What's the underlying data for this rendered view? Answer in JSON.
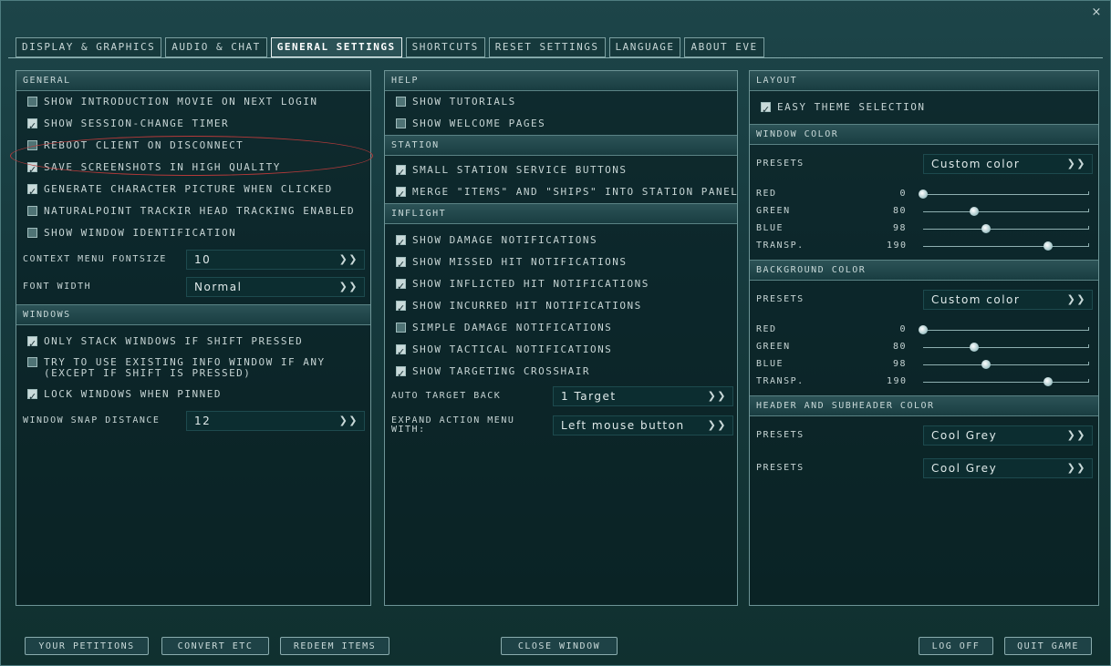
{
  "tabs": [
    {
      "label": "DISPLAY & GRAPHICS"
    },
    {
      "label": "AUDIO & CHAT"
    },
    {
      "label": "GENERAL SETTINGS"
    },
    {
      "label": "SHORTCUTS"
    },
    {
      "label": "RESET SETTINGS"
    },
    {
      "label": "LANGUAGE"
    },
    {
      "label": "ABOUT EVE"
    }
  ],
  "close": "×",
  "general": {
    "header": "GENERAL",
    "checks": [
      {
        "label": "SHOW INTRODUCTION MOVIE ON NEXT LOGIN",
        "checked": false
      },
      {
        "label": "SHOW SESSION-CHANGE TIMER",
        "checked": true
      },
      {
        "label": "REBOOT CLIENT ON DISCONNECT",
        "checked": false
      },
      {
        "label": "SAVE SCREENSHOTS IN HIGH QUALITY",
        "checked": true
      },
      {
        "label": "GENERATE CHARACTER PICTURE WHEN CLICKED",
        "checked": true
      },
      {
        "label": "NATURALPOINT TRACKIR HEAD TRACKING ENABLED",
        "checked": false
      },
      {
        "label": "SHOW WINDOW IDENTIFICATION",
        "checked": false
      }
    ],
    "context_menu_label": "CONTEXT MENU FONTSIZE",
    "context_menu_value": "10",
    "font_width_label": "FONT WIDTH",
    "font_width_value": "Normal",
    "windows_header": "WINDOWS",
    "win_checks": [
      {
        "label": "ONLY STACK WINDOWS IF SHIFT PRESSED",
        "checked": true
      },
      {
        "label": "TRY TO USE EXISTING INFO WINDOW IF ANY (EXCEPT IF SHIFT IS PRESSED)",
        "checked": false
      },
      {
        "label": "LOCK WINDOWS WHEN PINNED",
        "checked": true
      }
    ],
    "snap_label": "WINDOW SNAP DISTANCE",
    "snap_value": "12"
  },
  "help": {
    "header": "HELP",
    "checks": [
      {
        "label": "SHOW TUTORIALS",
        "checked": false
      },
      {
        "label": "SHOW WELCOME PAGES",
        "checked": false
      }
    ],
    "station_header": "STATION",
    "station_checks": [
      {
        "label": "SMALL STATION SERVICE BUTTONS",
        "checked": true
      },
      {
        "label": "MERGE \"ITEMS\" AND \"SHIPS\" INTO STATION PANEL",
        "checked": true
      }
    ],
    "inflight_header": "INFLIGHT",
    "inflight_checks": [
      {
        "label": "SHOW DAMAGE NOTIFICATIONS",
        "checked": true
      },
      {
        "label": "SHOW MISSED HIT NOTIFICATIONS",
        "checked": true
      },
      {
        "label": "SHOW INFLICTED HIT NOTIFICATIONS",
        "checked": true
      },
      {
        "label": "SHOW INCURRED HIT NOTIFICATIONS",
        "checked": true
      },
      {
        "label": "SIMPLE DAMAGE NOTIFICATIONS",
        "checked": false
      },
      {
        "label": "SHOW TACTICAL NOTIFICATIONS",
        "checked": true
      },
      {
        "label": "SHOW TARGETING CROSSHAIR",
        "checked": true
      }
    ],
    "auto_target_label": "AUTO TARGET BACK",
    "auto_target_value": "1 Target",
    "expand_label": "EXPAND ACTION MENU WITH:",
    "expand_value": "Left mouse button"
  },
  "layout": {
    "header": "LAYOUT",
    "easy_theme": {
      "label": "EASY THEME SELECTION",
      "checked": true
    },
    "window_color_header": "WINDOW COLOR",
    "presets_label": "PRESETS",
    "window_preset": "Custom color",
    "window_sliders": [
      {
        "label": "RED",
        "value": "0",
        "pos": 0.0
      },
      {
        "label": "GREEN",
        "value": "80",
        "pos": 0.31
      },
      {
        "label": "BLUE",
        "value": "98",
        "pos": 0.38
      },
      {
        "label": "TRANSP.",
        "value": "190",
        "pos": 0.75
      }
    ],
    "bg_color_header": "BACKGROUND COLOR",
    "bg_preset": "Custom color",
    "bg_sliders": [
      {
        "label": "RED",
        "value": "0",
        "pos": 0.0
      },
      {
        "label": "GREEN",
        "value": "80",
        "pos": 0.31
      },
      {
        "label": "BLUE",
        "value": "98",
        "pos": 0.38
      },
      {
        "label": "TRANSP.",
        "value": "190",
        "pos": 0.75
      }
    ],
    "header_color_header": "HEADER AND SUBHEADER COLOR",
    "header_preset_1": "Cool Grey",
    "header_preset_2": "Cool Grey"
  },
  "bottom": {
    "petitions": "YOUR PETITIONS",
    "convert": "CONVERT ETC",
    "redeem": "REDEEM ITEMS",
    "close": "CLOSE WINDOW",
    "logoff": "LOG OFF",
    "quit": "QUIT GAME"
  },
  "icons": {
    "dropdown": "chevron-double-down-icon",
    "checkbox": "checkbox-icon",
    "close": "close-icon"
  },
  "colors": {
    "accent": "#c9dada",
    "background": "#163a3e",
    "annotation": "#b53a3a"
  }
}
